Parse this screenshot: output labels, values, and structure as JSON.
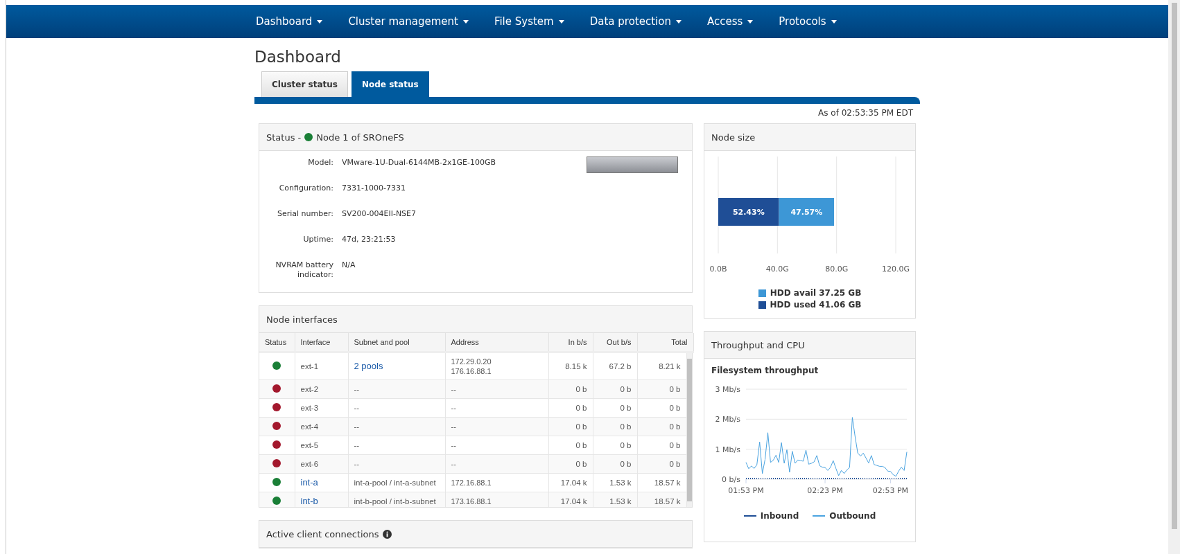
{
  "nav": [
    {
      "label": "Dashboard"
    },
    {
      "label": "Cluster management"
    },
    {
      "label": "File System"
    },
    {
      "label": "Data protection"
    },
    {
      "label": "Access"
    },
    {
      "label": "Protocols"
    }
  ],
  "page_title": "Dashboard",
  "tabs": [
    {
      "label": "Cluster status",
      "selected": false
    },
    {
      "label": "Node status",
      "selected": true
    }
  ],
  "timestamp": "As of 02:53:35 PM EDT",
  "status_panel": {
    "title_prefix": "Status -",
    "node_up": true,
    "title": "Node 1 of SROneFS",
    "fields": [
      {
        "label": "Model:",
        "value": "VMware-1U-Dual-6144MB-2x1GE-100GB"
      },
      {
        "label": "Configuration:",
        "value": "7331-1000-7331"
      },
      {
        "label": "Serial number:",
        "value": "SV200-004EII-NSE7"
      },
      {
        "label": "Uptime:",
        "value": "47d, 23:21:53"
      },
      {
        "label": "NVRAM battery indicator:",
        "value": "N/A"
      }
    ]
  },
  "interfaces": {
    "title": "Node interfaces",
    "columns": [
      "Status",
      "Interface",
      "Subnet and pool",
      "Address",
      "In b/s",
      "Out b/s",
      "Total"
    ],
    "rows": [
      {
        "up": true,
        "interface": "ext-1",
        "interface_link": false,
        "subnet": "2 pools",
        "subnet_link": true,
        "address": [
          "172.29.0.20",
          "176.16.88.1"
        ],
        "in": "8.15 k",
        "out": "67.2 b",
        "total": "8.21 k"
      },
      {
        "up": false,
        "interface": "ext-2",
        "interface_link": false,
        "subnet": "--",
        "subnet_link": false,
        "address": [
          "--"
        ],
        "in": "0 b",
        "out": "0 b",
        "total": "0 b"
      },
      {
        "up": false,
        "interface": "ext-3",
        "interface_link": false,
        "subnet": "--",
        "subnet_link": false,
        "address": [
          "--"
        ],
        "in": "0 b",
        "out": "0 b",
        "total": "0 b"
      },
      {
        "up": false,
        "interface": "ext-4",
        "interface_link": false,
        "subnet": "--",
        "subnet_link": false,
        "address": [
          "--"
        ],
        "in": "0 b",
        "out": "0 b",
        "total": "0 b"
      },
      {
        "up": false,
        "interface": "ext-5",
        "interface_link": false,
        "subnet": "--",
        "subnet_link": false,
        "address": [
          "--"
        ],
        "in": "0 b",
        "out": "0 b",
        "total": "0 b"
      },
      {
        "up": false,
        "interface": "ext-6",
        "interface_link": false,
        "subnet": "--",
        "subnet_link": false,
        "address": [
          "--"
        ],
        "in": "0 b",
        "out": "0 b",
        "total": "0 b"
      },
      {
        "up": true,
        "interface": "int-a",
        "interface_link": true,
        "subnet": "int-a-pool / int-a-subnet",
        "subnet_link": false,
        "address": [
          "172.16.88.1"
        ],
        "in": "17.04 k",
        "out": "1.53 k",
        "total": "18.57 k"
      },
      {
        "up": true,
        "interface": "int-b",
        "interface_link": true,
        "subnet": "int-b-pool / int-b-subnet",
        "subnet_link": false,
        "address": [
          "173.16.88.1"
        ],
        "in": "17.04 k",
        "out": "1.53 k",
        "total": "18.57 k"
      }
    ]
  },
  "connections_panel": {
    "title": "Active client connections"
  },
  "node_size": {
    "title": "Node size",
    "chart_data": {
      "type": "bar",
      "orientation": "horizontal",
      "stacked": true,
      "xlim": [
        0,
        120
      ],
      "xticks": [
        {
          "value": 0,
          "label": "0.0B"
        },
        {
          "value": 40,
          "label": "40.0G"
        },
        {
          "value": 80,
          "label": "80.0G"
        },
        {
          "value": 120,
          "label": "120.0G"
        }
      ],
      "series": [
        {
          "name": "HDD used 41.06 GB",
          "color": "#1f4e96",
          "values": [
            41.06
          ]
        },
        {
          "name": "HDD avail 37.25 GB",
          "color": "#3d97d6",
          "values": [
            37.25
          ]
        }
      ],
      "value_labels": [
        "52.43%",
        "47.57%"
      ]
    }
  },
  "throughput": {
    "title": "Throughput and CPU",
    "chart_data": {
      "type": "line",
      "title": "Filesystem throughput",
      "ylim": [
        0,
        3
      ],
      "categories": [
        "01:53 PM",
        null,
        null,
        null,
        null,
        null,
        null,
        null,
        null,
        null,
        null,
        null,
        null,
        null,
        null,
        null,
        null,
        null,
        null,
        null,
        null,
        null,
        null,
        null,
        null,
        null,
        null,
        null,
        null,
        "02:23 PM",
        null,
        null,
        null,
        null,
        null,
        null,
        null,
        null,
        null,
        null,
        null,
        null,
        null,
        null,
        null,
        null,
        null,
        null,
        null,
        null,
        null,
        null,
        null,
        "02:53 PM",
        null,
        null,
        null,
        null,
        null,
        null
      ],
      "yticks": [
        {
          "value": 0,
          "label": "0 b/s"
        },
        {
          "value": 1,
          "label": "1 Mb/s"
        },
        {
          "value": 2,
          "label": "2 Mb/s"
        },
        {
          "value": 3,
          "label": "3 Mb/s"
        }
      ],
      "series": [
        {
          "name": "Inbound",
          "color": "#1f4e96",
          "line_style": "dotted",
          "values": [
            0.02,
            0.02,
            0.02,
            0.02,
            0.02,
            0.02,
            0.02,
            0.02,
            0.02,
            0.02,
            0.02,
            0.02,
            0.02,
            0.02,
            0.02,
            0.02,
            0.02,
            0.02,
            0.02,
            0.02,
            0.02,
            0.02,
            0.02,
            0.02,
            0.02,
            0.02,
            0.02,
            0.02,
            0.02,
            0.02,
            0.02,
            0.02,
            0.02,
            0.02,
            0.02,
            0.02,
            0.02,
            0.02,
            0.02,
            0.02,
            0.02,
            0.02,
            0.02,
            0.02,
            0.02,
            0.02,
            0.02,
            0.02,
            0.02,
            0.02,
            0.02,
            0.02,
            0.02,
            0.02,
            0.02,
            0.02,
            0.02,
            0.02,
            0.02,
            0.02
          ]
        },
        {
          "name": "Outbound",
          "color": "#4aa3e0",
          "values": [
            0.56,
            0.35,
            0.44,
            0.36,
            0.48,
            1.24,
            0.19,
            0.66,
            1.55,
            0.56,
            0.63,
            0.8,
            0.56,
            1.22,
            0.53,
            0.98,
            0.23,
            0.93,
            0.53,
            0.64,
            0.62,
            0.6,
            0.97,
            0.5,
            0.53,
            0.58,
            0.79,
            0.45,
            0.4,
            0.39,
            0.29,
            0.4,
            0.62,
            0.35,
            0.12,
            0.29,
            0.19,
            0.31,
            0.39,
            2.06,
            1.43,
            0.87,
            0.77,
            0.87,
            0.71,
            0.54,
            0.79,
            0.49,
            0.46,
            0.43,
            0.43,
            0.39,
            0.27,
            0.26,
            0.15,
            0.1,
            0.27,
            0.4,
            0.29,
            0.91
          ]
        }
      ]
    }
  }
}
